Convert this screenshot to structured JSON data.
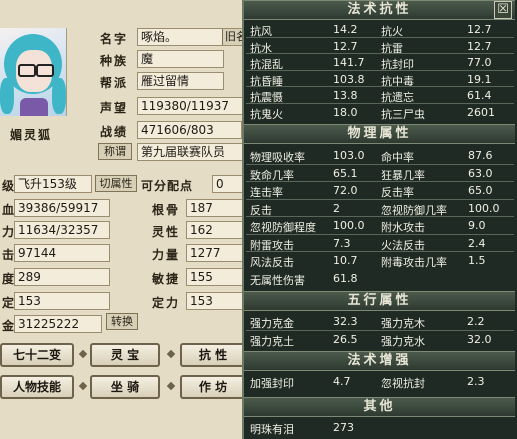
{
  "character": {
    "portrait_name": "媚灵狐",
    "name_label": "名字",
    "name_value": "啄焰。",
    "name_tag": "旧名",
    "race_label": "种族",
    "race_value": "魔",
    "sect_label": "帮派",
    "sect_value": "雁过留情",
    "fame_label": "声望",
    "fame_value": "119380/11937",
    "record_label": "战绩",
    "record_value": "471606/803",
    "title_button": "称谓",
    "title_value": "第九届联赛队员"
  },
  "stats": {
    "level_label": "级",
    "level_value": "飞升153级",
    "modify_button": "切属性",
    "alloc_label": "可分配点",
    "alloc_value": "0",
    "hp_label": "血",
    "hp_value": "39386/59917",
    "mp_label": "力",
    "mp_value": "11634/32357",
    "atk_label": "击",
    "atk_value": "97144",
    "def_label": "度",
    "def_value": "289",
    "spd_label": "定",
    "spd_value": "153",
    "money_label": "金",
    "money_value": "31225222",
    "exchange_button": "转换",
    "root_label": "根骨",
    "root_value": "187",
    "spirit_label": "灵性",
    "spirit_value": "162",
    "power_label": "力量",
    "power_value": "1277",
    "agility_label": "敏捷",
    "agility_value": "155",
    "focus_label": "定力",
    "focus_value": "153"
  },
  "buttons": {
    "row1": [
      "七十二变",
      "灵 宝",
      "抗 性"
    ],
    "row2": [
      "人物技能",
      "坐 骑",
      "作 坊"
    ]
  },
  "resist_panel": {
    "title": "法术抗性",
    "rows": [
      [
        "抗风",
        "14.2",
        "抗火",
        "12.7"
      ],
      [
        "抗水",
        "12.7",
        "抗雷",
        "12.7"
      ],
      [
        "抗混乱",
        "141.7",
        "抗封印",
        "77.0"
      ],
      [
        "抗昏睡",
        "103.8",
        "抗中毒",
        "19.1"
      ],
      [
        "抗震慑",
        "13.8",
        "抗遗忘",
        "61.4"
      ],
      [
        "抗鬼火",
        "18.0",
        "抗三尸虫",
        "2601"
      ]
    ]
  },
  "physical_panel": {
    "title": "物理属性",
    "rows": [
      [
        "物理吸收率",
        "103.0",
        "命中率",
        "87.6"
      ],
      [
        "致命几率",
        "65.1",
        "狂暴几率",
        "63.0"
      ],
      [
        "连击率",
        "72.0",
        "反击率",
        "65.0"
      ],
      [
        "反击",
        "2",
        "忽视防御几率",
        "100.0"
      ],
      [
        "忽视防御程度",
        "100.0",
        "附水攻击",
        "9.0"
      ],
      [
        "附雷攻击",
        "7.3",
        "火法反击",
        "2.4"
      ],
      [
        "风法反击",
        "10.7",
        "附毒攻击几率",
        "1.5"
      ]
    ],
    "last_label": "无属性伤害",
    "last_value": "61.8"
  },
  "element_panel": {
    "title": "五行属性",
    "rows": [
      [
        "强力克金",
        "32.3",
        "强力克木",
        "2.2"
      ],
      [
        "强力克土",
        "26.5",
        "强力克水",
        "32.0"
      ]
    ]
  },
  "boost_panel": {
    "title": "法术增强",
    "rows": [
      [
        "加强封印",
        "4.7",
        "忽视抗封",
        "2.3"
      ]
    ]
  },
  "other_panel": {
    "title": "其他",
    "rows": [
      [
        "明珠有泪",
        "273"
      ]
    ]
  },
  "close_glyph": "☒"
}
